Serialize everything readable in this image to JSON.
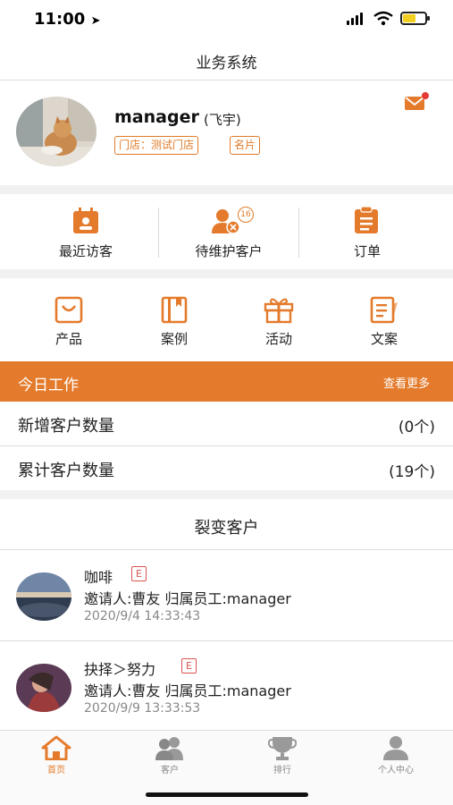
{
  "status_bar": {
    "time": "11:00"
  },
  "header": {
    "title": "业务系统"
  },
  "profile": {
    "username": "manager",
    "nickname": "(飞宇)",
    "store_tag": "门店：测试门店",
    "card_tag": "名片"
  },
  "quick_actions": [
    {
      "label": "最近访客",
      "icon": "calendar-icon"
    },
    {
      "label": "待维护客户",
      "icon": "user-remove-icon",
      "badge": "16"
    },
    {
      "label": "订单",
      "icon": "clipboard-icon"
    }
  ],
  "grid_menu": [
    {
      "label": "产品",
      "icon": "bag-icon"
    },
    {
      "label": "案例",
      "icon": "book-icon"
    },
    {
      "label": "活动",
      "icon": "gift-icon"
    },
    {
      "label": "文案",
      "icon": "document-icon"
    }
  ],
  "today_work": {
    "title": "今日工作",
    "more": "查看更多",
    "rows": [
      {
        "label": "新增客户数量",
        "value": "(0个)"
      },
      {
        "label": "累计客户数量",
        "value": "(19个)"
      }
    ]
  },
  "referral": {
    "title": "裂变客户",
    "items": [
      {
        "name": "咖啡",
        "tag": "E",
        "info": "邀请人:曹友   归属员工:manager",
        "time": "2020/9/4 14:33:43"
      },
      {
        "name": "抉择＞努力",
        "tag": "E",
        "info": "邀请人:曹友   归属员工:manager",
        "time": "2020/9/9 13:33:53"
      }
    ]
  },
  "tabs": [
    {
      "label": "首页",
      "icon": "home-icon",
      "active": true
    },
    {
      "label": "客户",
      "icon": "users-icon"
    },
    {
      "label": "排行",
      "icon": "trophy-icon"
    },
    {
      "label": "个人中心",
      "icon": "person-icon"
    }
  ],
  "colors": {
    "accent": "#e47b2c",
    "tag_red": "#d9534f"
  }
}
